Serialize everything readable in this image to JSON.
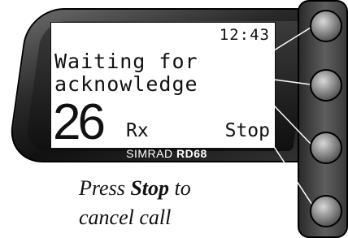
{
  "display": {
    "clock": "12:43",
    "message_line1": "Waiting for",
    "message_line2": "acknowledge",
    "channel": "26",
    "mode": "Rx",
    "soft_key_label": "Stop"
  },
  "device": {
    "brand": "SIMRAD",
    "model": "RD68"
  },
  "caption": {
    "line1_before": "Press ",
    "line1_bold": "Stop",
    "line1_after": " to",
    "line2": "cancel call"
  },
  "colors": {
    "bezel_dark": "#1a1a1a",
    "screen_bg": "#ffffff",
    "text": "#111111"
  },
  "icons": {
    "soft_keys": [
      "soft-key-button",
      "soft-key-button",
      "soft-key-button",
      "soft-key-button"
    ]
  }
}
